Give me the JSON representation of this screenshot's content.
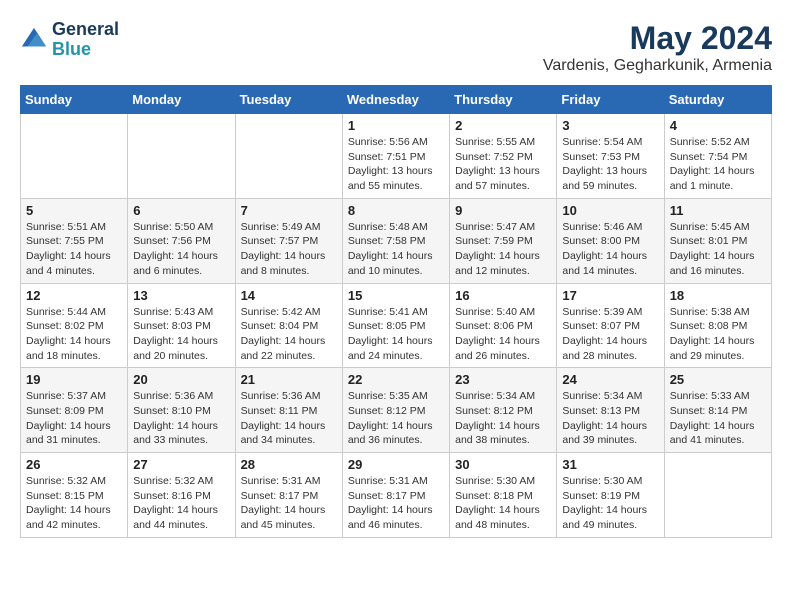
{
  "header": {
    "logo_line1": "General",
    "logo_line2": "Blue",
    "title": "May 2024",
    "subtitle": "Vardenis, Gegharkunik, Armenia"
  },
  "days_of_week": [
    "Sunday",
    "Monday",
    "Tuesday",
    "Wednesday",
    "Thursday",
    "Friday",
    "Saturday"
  ],
  "weeks": [
    [
      {
        "day": "",
        "info": ""
      },
      {
        "day": "",
        "info": ""
      },
      {
        "day": "",
        "info": ""
      },
      {
        "day": "1",
        "info": "Sunrise: 5:56 AM\nSunset: 7:51 PM\nDaylight: 13 hours and 55 minutes."
      },
      {
        "day": "2",
        "info": "Sunrise: 5:55 AM\nSunset: 7:52 PM\nDaylight: 13 hours and 57 minutes."
      },
      {
        "day": "3",
        "info": "Sunrise: 5:54 AM\nSunset: 7:53 PM\nDaylight: 13 hours and 59 minutes."
      },
      {
        "day": "4",
        "info": "Sunrise: 5:52 AM\nSunset: 7:54 PM\nDaylight: 14 hours and 1 minute."
      }
    ],
    [
      {
        "day": "5",
        "info": "Sunrise: 5:51 AM\nSunset: 7:55 PM\nDaylight: 14 hours and 4 minutes."
      },
      {
        "day": "6",
        "info": "Sunrise: 5:50 AM\nSunset: 7:56 PM\nDaylight: 14 hours and 6 minutes."
      },
      {
        "day": "7",
        "info": "Sunrise: 5:49 AM\nSunset: 7:57 PM\nDaylight: 14 hours and 8 minutes."
      },
      {
        "day": "8",
        "info": "Sunrise: 5:48 AM\nSunset: 7:58 PM\nDaylight: 14 hours and 10 minutes."
      },
      {
        "day": "9",
        "info": "Sunrise: 5:47 AM\nSunset: 7:59 PM\nDaylight: 14 hours and 12 minutes."
      },
      {
        "day": "10",
        "info": "Sunrise: 5:46 AM\nSunset: 8:00 PM\nDaylight: 14 hours and 14 minutes."
      },
      {
        "day": "11",
        "info": "Sunrise: 5:45 AM\nSunset: 8:01 PM\nDaylight: 14 hours and 16 minutes."
      }
    ],
    [
      {
        "day": "12",
        "info": "Sunrise: 5:44 AM\nSunset: 8:02 PM\nDaylight: 14 hours and 18 minutes."
      },
      {
        "day": "13",
        "info": "Sunrise: 5:43 AM\nSunset: 8:03 PM\nDaylight: 14 hours and 20 minutes."
      },
      {
        "day": "14",
        "info": "Sunrise: 5:42 AM\nSunset: 8:04 PM\nDaylight: 14 hours and 22 minutes."
      },
      {
        "day": "15",
        "info": "Sunrise: 5:41 AM\nSunset: 8:05 PM\nDaylight: 14 hours and 24 minutes."
      },
      {
        "day": "16",
        "info": "Sunrise: 5:40 AM\nSunset: 8:06 PM\nDaylight: 14 hours and 26 minutes."
      },
      {
        "day": "17",
        "info": "Sunrise: 5:39 AM\nSunset: 8:07 PM\nDaylight: 14 hours and 28 minutes."
      },
      {
        "day": "18",
        "info": "Sunrise: 5:38 AM\nSunset: 8:08 PM\nDaylight: 14 hours and 29 minutes."
      }
    ],
    [
      {
        "day": "19",
        "info": "Sunrise: 5:37 AM\nSunset: 8:09 PM\nDaylight: 14 hours and 31 minutes."
      },
      {
        "day": "20",
        "info": "Sunrise: 5:36 AM\nSunset: 8:10 PM\nDaylight: 14 hours and 33 minutes."
      },
      {
        "day": "21",
        "info": "Sunrise: 5:36 AM\nSunset: 8:11 PM\nDaylight: 14 hours and 34 minutes."
      },
      {
        "day": "22",
        "info": "Sunrise: 5:35 AM\nSunset: 8:12 PM\nDaylight: 14 hours and 36 minutes."
      },
      {
        "day": "23",
        "info": "Sunrise: 5:34 AM\nSunset: 8:12 PM\nDaylight: 14 hours and 38 minutes."
      },
      {
        "day": "24",
        "info": "Sunrise: 5:34 AM\nSunset: 8:13 PM\nDaylight: 14 hours and 39 minutes."
      },
      {
        "day": "25",
        "info": "Sunrise: 5:33 AM\nSunset: 8:14 PM\nDaylight: 14 hours and 41 minutes."
      }
    ],
    [
      {
        "day": "26",
        "info": "Sunrise: 5:32 AM\nSunset: 8:15 PM\nDaylight: 14 hours and 42 minutes."
      },
      {
        "day": "27",
        "info": "Sunrise: 5:32 AM\nSunset: 8:16 PM\nDaylight: 14 hours and 44 minutes."
      },
      {
        "day": "28",
        "info": "Sunrise: 5:31 AM\nSunset: 8:17 PM\nDaylight: 14 hours and 45 minutes."
      },
      {
        "day": "29",
        "info": "Sunrise: 5:31 AM\nSunset: 8:17 PM\nDaylight: 14 hours and 46 minutes."
      },
      {
        "day": "30",
        "info": "Sunrise: 5:30 AM\nSunset: 8:18 PM\nDaylight: 14 hours and 48 minutes."
      },
      {
        "day": "31",
        "info": "Sunrise: 5:30 AM\nSunset: 8:19 PM\nDaylight: 14 hours and 49 minutes."
      },
      {
        "day": "",
        "info": ""
      }
    ]
  ]
}
